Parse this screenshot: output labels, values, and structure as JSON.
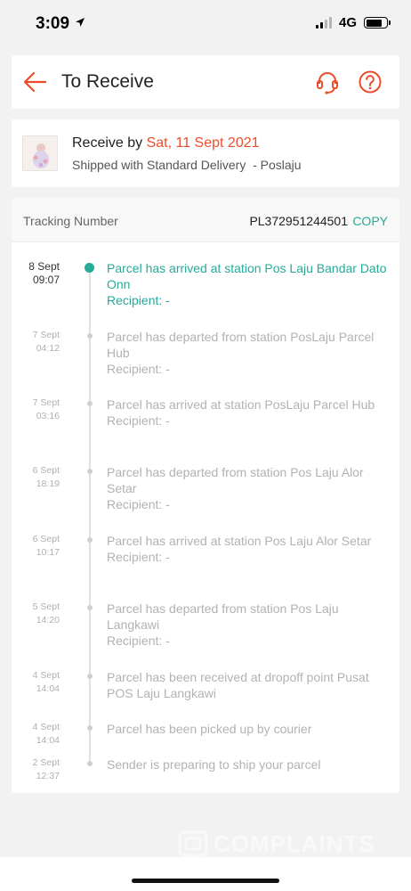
{
  "status_bar": {
    "time": "3:09",
    "network": "4G"
  },
  "header": {
    "title": "To Receive",
    "accent_color": "#ee4d2d"
  },
  "delivery": {
    "receive_prefix": "Receive by ",
    "receive_date": "Sat, 11 Sept 2021",
    "shipping_text": "Shipped with Standard Delivery  - Poslaju"
  },
  "tracking": {
    "label": "Tracking Number",
    "number": "PL372951244501",
    "copy_label": "COPY",
    "active_color": "#26aa99"
  },
  "events": [
    {
      "date": "8 Sept",
      "time": "09:07",
      "description": "Parcel has arrived at station Pos Laju Bandar Dato Onn",
      "recipient": "Recipient: -"
    },
    {
      "date": "7 Sept",
      "time": "04:12",
      "description": "Parcel has departed from station PosLaju Parcel Hub",
      "recipient": "Recipient: -"
    },
    {
      "date": "7 Sept",
      "time": "03:16",
      "description": "Parcel has arrived at station PosLaju Parcel Hub",
      "recipient": "Recipient: -"
    },
    {
      "date": "6 Sept",
      "time": "18:19",
      "description": "Parcel has departed from station Pos Laju Alor Setar",
      "recipient": "Recipient: -"
    },
    {
      "date": "6 Sept",
      "time": "10:17",
      "description": "Parcel has arrived at station Pos Laju Alor Setar",
      "recipient": "Recipient: -"
    },
    {
      "date": "5 Sept",
      "time": "14:20",
      "description": "Parcel has departed from station Pos Laju Langkawi",
      "recipient": "Recipient: -"
    },
    {
      "date": "4 Sept",
      "time": "14:04",
      "description": "Parcel has been received at dropoff point Pusat POS Laju Langkawi"
    },
    {
      "date": "4 Sept",
      "time": "14:04",
      "description": "Parcel has been picked up by courier"
    },
    {
      "date": "2 Sept",
      "time": "12:37",
      "description": "Sender is preparing to ship your parcel"
    }
  ],
  "watermark": {
    "text": "COMPLAINTS"
  }
}
